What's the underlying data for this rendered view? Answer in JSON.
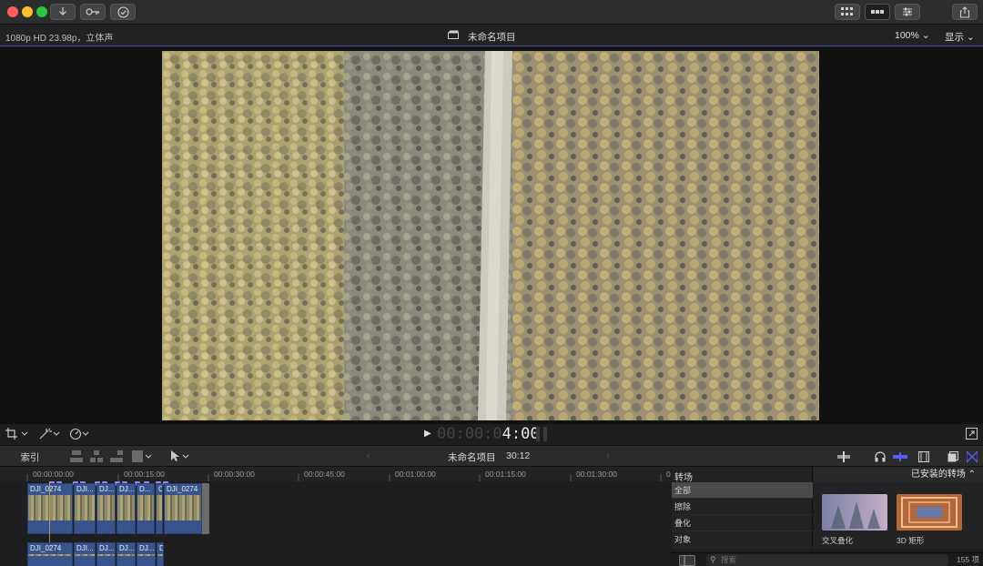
{
  "window": {
    "project_title": "未命名项目"
  },
  "viewer": {
    "format": "1080p HD 23.98p，立体声",
    "title": "未命名项目",
    "zoom": "100%",
    "view_menu": "显示",
    "timecode_dim": "00:00:0",
    "timecode_lit": "4:00"
  },
  "timeline_toolbar": {
    "index_label": "索引",
    "project_name": "未命名项目",
    "duration": "30:12"
  },
  "ruler": {
    "ticks": [
      "00:00:00:00",
      "00:00:15:00",
      "00:00:30:00",
      "00:00:45:00",
      "00:01:00:00",
      "00:01:15:00",
      "00:01:30:00",
      "0"
    ]
  },
  "clips_upper": [
    {
      "name": "DJI_0274"
    },
    {
      "name": "DJI..."
    },
    {
      "name": "DJ..."
    },
    {
      "name": "DJ..."
    },
    {
      "name": "D..."
    },
    {
      "name": "C"
    },
    {
      "name": "DJI_0274"
    }
  ],
  "clips_lower": [
    {
      "name": "DJI_0274"
    },
    {
      "name": "DJI..."
    },
    {
      "name": "DJ..."
    },
    {
      "name": "DJ..."
    },
    {
      "name": "DJ..."
    },
    {
      "name": "D"
    }
  ],
  "browser": {
    "category_header": "转场",
    "categories": [
      "全部",
      "擦除",
      "叠化",
      "对象"
    ],
    "installed_label": "已安装的转场",
    "transitions": [
      {
        "label": "交叉叠化"
      },
      {
        "label": "3D 矩形"
      }
    ],
    "search_placeholder": "搜索",
    "item_count": "155 项"
  },
  "colors": {
    "accent": "#5a5ef0",
    "clip_blue": "#39548c",
    "traffic_red": "#fe5f57",
    "traffic_yellow": "#febc2e",
    "traffic_green": "#28c840"
  }
}
